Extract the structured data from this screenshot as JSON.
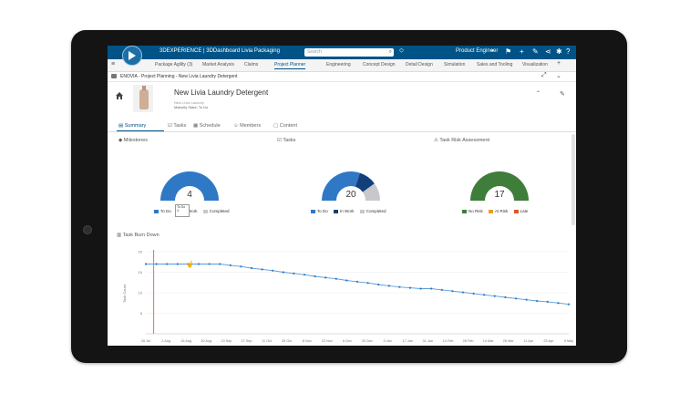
{
  "app": {
    "brand": "3DEXPERIENCE | 3DDashboard  Livia Packaging",
    "search_placeholder": "Search",
    "role": "Product Engineer",
    "tabs": [
      "Package Agility (3)",
      "Market Analysis",
      "Claims",
      "Project Planner",
      "Engineering",
      "Concept Design",
      "Detail Design",
      "Simulation",
      "Sales and Tooling",
      "Visualization"
    ],
    "active_tab": 3
  },
  "widget": {
    "title": "ENOVIA - Project Planning - New Livia Laundry Detergent"
  },
  "project": {
    "name": "New Livia Laundry Detergent",
    "description": "New Livia Laundry",
    "maturity": "Maturity State: To Do"
  },
  "subtabs": [
    "Summary",
    "Tasks",
    "Schedule",
    "Members",
    "Content"
  ],
  "milestones": {
    "title": "Milestones",
    "center_value": "4",
    "tooltip": "To Do 4",
    "legend": [
      {
        "label": "To Do",
        "color": "#2f78c6"
      },
      {
        "label": "In Work",
        "color": "#123f7c"
      },
      {
        "label": "Completed",
        "color": "#c6c8cc"
      }
    ],
    "split": [
      1.0,
      0.0,
      0.0
    ]
  },
  "tasks": {
    "title": "Tasks",
    "center_value": "20",
    "legend": [
      {
        "label": "To Do",
        "color": "#2f78c6"
      },
      {
        "label": "In Work",
        "color": "#123f7c"
      },
      {
        "label": "Completed",
        "color": "#c6c8cc"
      }
    ],
    "split": [
      0.6,
      0.2,
      0.2
    ]
  },
  "risk": {
    "title": "Task Risk Assessment",
    "center_value": "17",
    "legend": [
      {
        "label": "No Risk",
        "color": "#3e7d3a"
      },
      {
        "label": "At Risk",
        "color": "#e3a02a"
      },
      {
        "label": "Late",
        "color": "#d9582b"
      }
    ],
    "split": [
      1.0,
      0.0,
      0.0
    ]
  },
  "burndown": {
    "title": "Task Burn Down",
    "ylabel": "Task Count"
  },
  "chart_data": {
    "type": "line",
    "title": "Task Burn Down",
    "xlabel": "",
    "ylabel": "Task Count",
    "ylim": [
      0,
      20
    ],
    "yticks": [
      "20",
      "15",
      "10",
      "5"
    ],
    "x": [
      "26 Jul",
      "2 Aug",
      "9 Aug",
      "16 Aug",
      "23 Aug",
      "30 Aug",
      "6 Sep",
      "13 Sep",
      "20 Sep",
      "27 Sep",
      "4 Oct",
      "11 Oct",
      "18 Oct",
      "25 Oct",
      "1 Nov",
      "8 Nov",
      "15 Nov",
      "22 Nov",
      "29 Nov",
      "6 Dec",
      "13 Dec",
      "20 Dec",
      "27 Dec",
      "3 Jan",
      "10 Jan",
      "17 Jan",
      "24 Jan",
      "31 Jan",
      "7 Feb",
      "14 Feb",
      "21 Feb",
      "28 Feb",
      "7 Mar",
      "14 Mar",
      "21 Mar",
      "28 Mar",
      "4 Apr",
      "11 Apr",
      "18 Apr",
      "25 Apr",
      "2 May"
    ],
    "x_tick_labels": [
      "26 Jul",
      "2 Aug",
      "16 Aug",
      "30 Aug",
      "13 Sep",
      "27 Sep",
      "11 Oct",
      "25 Oct",
      "8 Nov",
      "22 Nov",
      "6 Dec",
      "20 Dec",
      "3 Jan",
      "17 Jan",
      "31 Jan",
      "14 Feb",
      "28 Feb",
      "14 Mar",
      "28 Mar",
      "11 Apr",
      "25 Apr",
      "9 May"
    ],
    "series": [
      {
        "values": [
          17,
          17,
          17,
          17,
          17,
          17,
          17,
          17,
          16.7,
          16.4,
          16,
          15.7,
          15.4,
          15,
          14.7,
          14.4,
          14,
          13.7,
          13.4,
          13,
          12.7,
          12.4,
          12,
          11.7,
          11.4,
          11.2,
          11,
          11,
          10.7,
          10.4,
          10.1,
          9.8,
          9.5,
          9.2,
          8.9,
          8.6,
          8.3,
          8,
          7.8,
          7.5,
          7.2
        ]
      }
    ],
    "today_marker": "2 Aug",
    "grid": true
  }
}
